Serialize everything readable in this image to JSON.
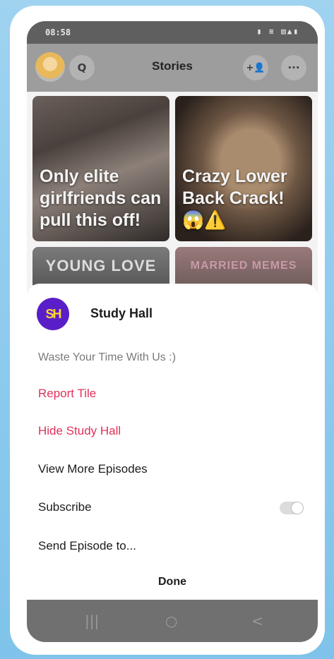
{
  "status_bar": {
    "time": "08:58",
    "icons_text": "▮ ≋ ▥▲▮"
  },
  "header": {
    "title": "Stories",
    "search_glyph": "Q",
    "add_friend_glyph": "+👤",
    "more_glyph": "···"
  },
  "stories": [
    {
      "caption": "Only elite girlfriends can pull this off!"
    },
    {
      "caption": "Crazy Lower Back Crack! 😱⚠️"
    },
    {
      "caption": "YOUNG LOVE"
    },
    {
      "caption": "MARRIED MEMES"
    }
  ],
  "sheet": {
    "publisher": {
      "logo_text": "SH",
      "name": "Study Hall",
      "description": "Waste Your Time With Us :)"
    },
    "menu": {
      "report": "Report Tile",
      "hide": "Hide Study Hall",
      "more": "View More Episodes",
      "subscribe": "Subscribe",
      "send": "Send Episode to..."
    },
    "subscribe_on": false,
    "done": "Done"
  },
  "nav": {
    "recents": "|||",
    "home": "○",
    "back": "<"
  },
  "colors": {
    "background": "#8ecbee",
    "accent_red": "#e0305a",
    "publisher_purple": "#5a1ec9",
    "publisher_yellow": "#ffd534"
  }
}
